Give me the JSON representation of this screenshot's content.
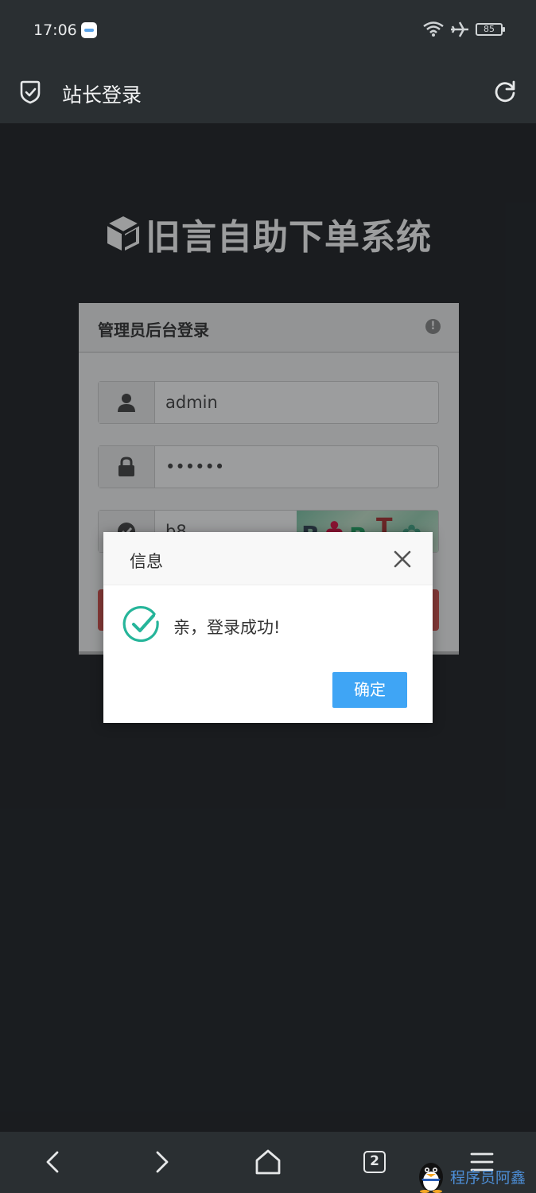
{
  "status_bar": {
    "time": "17:06",
    "battery": "85",
    "icons": [
      "app-notification-icon",
      "wifi-icon",
      "airplane-icon",
      "battery-icon"
    ]
  },
  "browser": {
    "page_title": "站长登录",
    "icons": [
      "shield-check-icon",
      "reload-icon"
    ]
  },
  "site": {
    "title": "旧言自助下单系统",
    "icon": "cube-icon"
  },
  "login_panel": {
    "title": "管理员后台登录",
    "username_value": "admin",
    "password_value": "••••••",
    "captcha_value": "b8"
  },
  "dialog": {
    "title": "信息",
    "message": "亲，登录成功!",
    "ok_label": "确定",
    "success_color": "#26b59a",
    "button_color": "#3fa5f5"
  },
  "bottom_nav": {
    "tab_count": "2",
    "icons": [
      "back-icon",
      "forward-icon",
      "home-icon",
      "tabs-icon",
      "menu-icon"
    ]
  },
  "watermark": {
    "text": "程序员阿鑫"
  }
}
